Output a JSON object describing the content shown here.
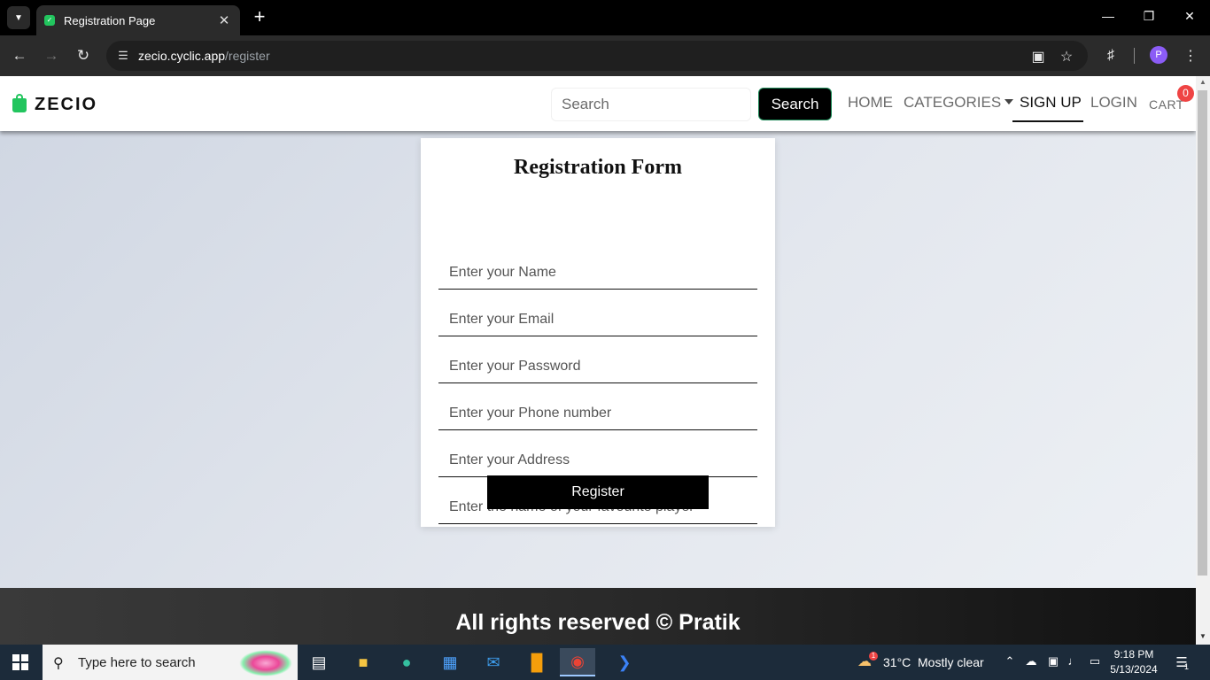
{
  "browser": {
    "tab_title": "Registration Page",
    "url_host": "zecio.cyclic.app",
    "url_path": "/register",
    "profile_initial": "P"
  },
  "navbar": {
    "brand": "ZECIO",
    "search_placeholder": "Search",
    "search_button": "Search",
    "links": {
      "home": "HOME",
      "categories": "CATEGORIES",
      "signup": "SIGN UP",
      "login": "LOGIN",
      "cart": "CART"
    },
    "cart_count": "0"
  },
  "form": {
    "title": "Registration Form",
    "fields": {
      "name": "Enter your Name",
      "email": "Enter your Email",
      "password": "Enter your Password",
      "phone": "Enter your Phone number",
      "address": "Enter your Address",
      "answer": "Enter the name of your favourite player"
    },
    "submit": "Register"
  },
  "footer": {
    "text": "All rights reserved © Pratik"
  },
  "taskbar": {
    "search_placeholder": "Type here to search",
    "weather_temp": "31°C",
    "weather_text": "Mostly clear",
    "weather_badge": "1",
    "time": "9:18 PM",
    "date": "5/13/2024",
    "notification_count": "1"
  },
  "colors": {
    "accent_green": "#22c55e",
    "cart_badge": "#ef4444",
    "button_black": "#000000"
  }
}
